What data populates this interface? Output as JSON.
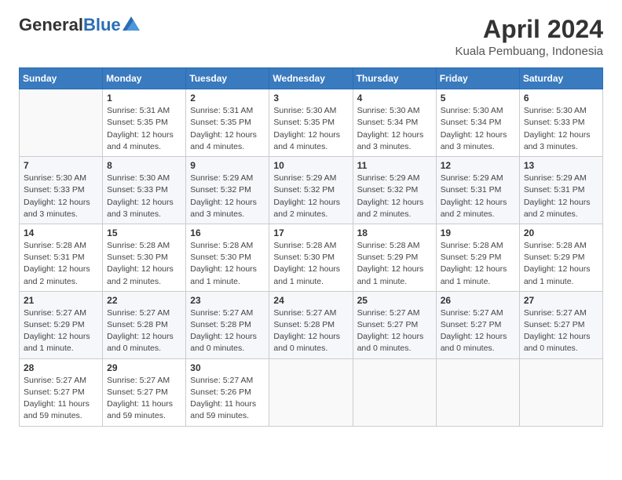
{
  "header": {
    "logo_general": "General",
    "logo_blue": "Blue",
    "month": "April 2024",
    "location": "Kuala Pembuang, Indonesia"
  },
  "weekdays": [
    "Sunday",
    "Monday",
    "Tuesday",
    "Wednesday",
    "Thursday",
    "Friday",
    "Saturday"
  ],
  "weeks": [
    [
      {
        "day": "",
        "info": ""
      },
      {
        "day": "1",
        "info": "Sunrise: 5:31 AM\nSunset: 5:35 PM\nDaylight: 12 hours\nand 4 minutes."
      },
      {
        "day": "2",
        "info": "Sunrise: 5:31 AM\nSunset: 5:35 PM\nDaylight: 12 hours\nand 4 minutes."
      },
      {
        "day": "3",
        "info": "Sunrise: 5:30 AM\nSunset: 5:35 PM\nDaylight: 12 hours\nand 4 minutes."
      },
      {
        "day": "4",
        "info": "Sunrise: 5:30 AM\nSunset: 5:34 PM\nDaylight: 12 hours\nand 3 minutes."
      },
      {
        "day": "5",
        "info": "Sunrise: 5:30 AM\nSunset: 5:34 PM\nDaylight: 12 hours\nand 3 minutes."
      },
      {
        "day": "6",
        "info": "Sunrise: 5:30 AM\nSunset: 5:33 PM\nDaylight: 12 hours\nand 3 minutes."
      }
    ],
    [
      {
        "day": "7",
        "info": "Sunrise: 5:30 AM\nSunset: 5:33 PM\nDaylight: 12 hours\nand 3 minutes."
      },
      {
        "day": "8",
        "info": "Sunrise: 5:30 AM\nSunset: 5:33 PM\nDaylight: 12 hours\nand 3 minutes."
      },
      {
        "day": "9",
        "info": "Sunrise: 5:29 AM\nSunset: 5:32 PM\nDaylight: 12 hours\nand 3 minutes."
      },
      {
        "day": "10",
        "info": "Sunrise: 5:29 AM\nSunset: 5:32 PM\nDaylight: 12 hours\nand 2 minutes."
      },
      {
        "day": "11",
        "info": "Sunrise: 5:29 AM\nSunset: 5:32 PM\nDaylight: 12 hours\nand 2 minutes."
      },
      {
        "day": "12",
        "info": "Sunrise: 5:29 AM\nSunset: 5:31 PM\nDaylight: 12 hours\nand 2 minutes."
      },
      {
        "day": "13",
        "info": "Sunrise: 5:29 AM\nSunset: 5:31 PM\nDaylight: 12 hours\nand 2 minutes."
      }
    ],
    [
      {
        "day": "14",
        "info": "Sunrise: 5:28 AM\nSunset: 5:31 PM\nDaylight: 12 hours\nand 2 minutes."
      },
      {
        "day": "15",
        "info": "Sunrise: 5:28 AM\nSunset: 5:30 PM\nDaylight: 12 hours\nand 2 minutes."
      },
      {
        "day": "16",
        "info": "Sunrise: 5:28 AM\nSunset: 5:30 PM\nDaylight: 12 hours\nand 1 minute."
      },
      {
        "day": "17",
        "info": "Sunrise: 5:28 AM\nSunset: 5:30 PM\nDaylight: 12 hours\nand 1 minute."
      },
      {
        "day": "18",
        "info": "Sunrise: 5:28 AM\nSunset: 5:29 PM\nDaylight: 12 hours\nand 1 minute."
      },
      {
        "day": "19",
        "info": "Sunrise: 5:28 AM\nSunset: 5:29 PM\nDaylight: 12 hours\nand 1 minute."
      },
      {
        "day": "20",
        "info": "Sunrise: 5:28 AM\nSunset: 5:29 PM\nDaylight: 12 hours\nand 1 minute."
      }
    ],
    [
      {
        "day": "21",
        "info": "Sunrise: 5:27 AM\nSunset: 5:29 PM\nDaylight: 12 hours\nand 1 minute."
      },
      {
        "day": "22",
        "info": "Sunrise: 5:27 AM\nSunset: 5:28 PM\nDaylight: 12 hours\nand 0 minutes."
      },
      {
        "day": "23",
        "info": "Sunrise: 5:27 AM\nSunset: 5:28 PM\nDaylight: 12 hours\nand 0 minutes."
      },
      {
        "day": "24",
        "info": "Sunrise: 5:27 AM\nSunset: 5:28 PM\nDaylight: 12 hours\nand 0 minutes."
      },
      {
        "day": "25",
        "info": "Sunrise: 5:27 AM\nSunset: 5:27 PM\nDaylight: 12 hours\nand 0 minutes."
      },
      {
        "day": "26",
        "info": "Sunrise: 5:27 AM\nSunset: 5:27 PM\nDaylight: 12 hours\nand 0 minutes."
      },
      {
        "day": "27",
        "info": "Sunrise: 5:27 AM\nSunset: 5:27 PM\nDaylight: 12 hours\nand 0 minutes."
      }
    ],
    [
      {
        "day": "28",
        "info": "Sunrise: 5:27 AM\nSunset: 5:27 PM\nDaylight: 11 hours\nand 59 minutes."
      },
      {
        "day": "29",
        "info": "Sunrise: 5:27 AM\nSunset: 5:27 PM\nDaylight: 11 hours\nand 59 minutes."
      },
      {
        "day": "30",
        "info": "Sunrise: 5:27 AM\nSunset: 5:26 PM\nDaylight: 11 hours\nand 59 minutes."
      },
      {
        "day": "",
        "info": ""
      },
      {
        "day": "",
        "info": ""
      },
      {
        "day": "",
        "info": ""
      },
      {
        "day": "",
        "info": ""
      }
    ]
  ]
}
